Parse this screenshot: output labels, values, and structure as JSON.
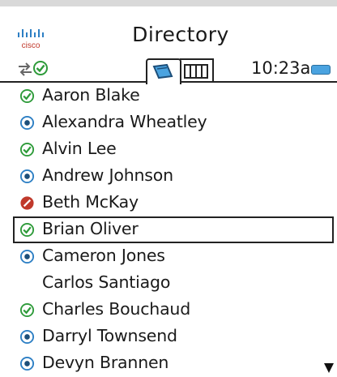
{
  "app": {
    "title": "Directory",
    "logo_text": "cisco"
  },
  "status": {
    "time": "10:23a",
    "sync_icon": "sync-arrows-icon",
    "presence_icon": "available-check-icon",
    "battery_icon": "battery-icon"
  },
  "tabs": [
    {
      "name": "contacts",
      "icon": "contacts-book-icon",
      "active": true
    },
    {
      "name": "keypad",
      "icon": "keypad-icon",
      "active": false
    }
  ],
  "colors": {
    "available": "#2e9b3a",
    "away": "#2d7fc4",
    "busy": "#c0392b",
    "accent": "#4aa3e0"
  },
  "contacts": [
    {
      "name": "Aaron Blake",
      "status": "available"
    },
    {
      "name": "Alexandra Wheatley",
      "status": "away"
    },
    {
      "name": "Alvin Lee",
      "status": "available"
    },
    {
      "name": "Andrew Johnson",
      "status": "away"
    },
    {
      "name": "Beth McKay",
      "status": "busy"
    },
    {
      "name": "Brian Oliver",
      "status": "available",
      "selected": true
    },
    {
      "name": "Cameron Jones",
      "status": "away"
    },
    {
      "name": "Carlos Santiago",
      "status": "none"
    },
    {
      "name": "Charles Bouchaud",
      "status": "available"
    },
    {
      "name": "Darryl Townsend",
      "status": "away"
    },
    {
      "name": "Devyn Brannen",
      "status": "away"
    }
  ]
}
